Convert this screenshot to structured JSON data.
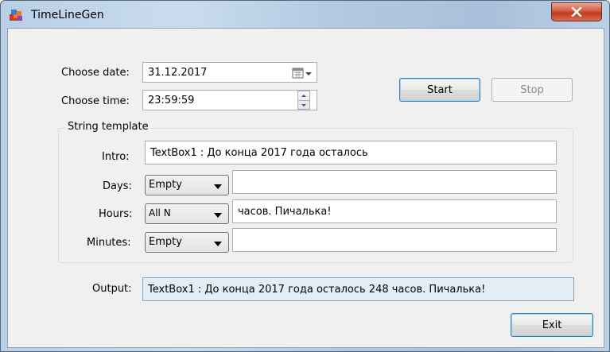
{
  "window": {
    "title": "TimeLineGen",
    "icons": {
      "app": "app-icon",
      "close": "close-icon"
    }
  },
  "form": {
    "date_label": "Choose date:",
    "date_value": "31.12.2017",
    "time_label": "Choose time:",
    "time_value": "23:59:59",
    "start_label": "Start",
    "stop_label": "Stop",
    "group_title": "String template",
    "intro_label": "Intro:",
    "intro_value": "TextBox1 : До конца 2017 года осталось",
    "days_label": "Days:",
    "days_mode": "Empty",
    "days_text": "",
    "hours_label": "Hours:",
    "hours_mode": "All N",
    "hours_text": "часов. Пичалька!",
    "minutes_label": "Minutes:",
    "minutes_mode": "Empty",
    "minutes_text": "",
    "output_label": "Output:",
    "output_value": "TextBox1 : До конца 2017 года осталось 248 часов. Пичалька!",
    "exit_label": "Exit"
  },
  "colors": {
    "accent": "#3c7fb1",
    "close_red": "#c03a20",
    "output_bg": "#e3edf5"
  }
}
